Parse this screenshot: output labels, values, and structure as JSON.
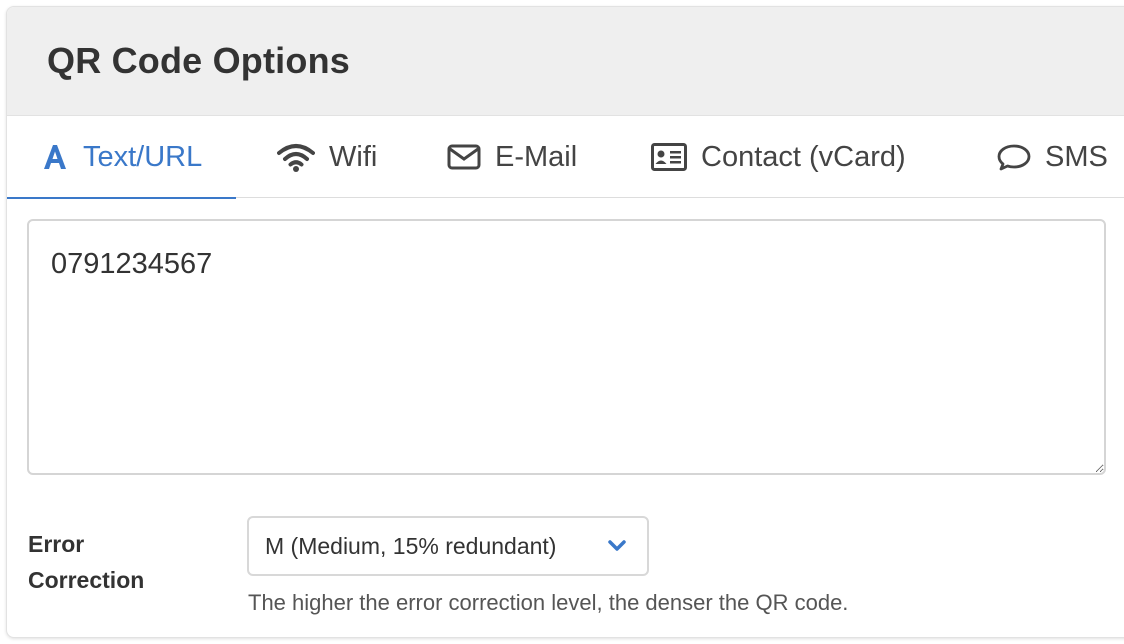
{
  "header": {
    "title": "QR Code Options"
  },
  "tabs": [
    {
      "label": "Text/URL",
      "icon": "text-icon",
      "active": true
    },
    {
      "label": "Wifi",
      "icon": "wifi-icon",
      "active": false
    },
    {
      "label": "E-Mail",
      "icon": "envelope-icon",
      "active": false
    },
    {
      "label": "Contact (vCard)",
      "icon": "contact-card-icon",
      "active": false
    },
    {
      "label": "SMS",
      "icon": "speech-bubble-icon",
      "active": false
    }
  ],
  "content": {
    "text_value": "0791234567"
  },
  "error_correction": {
    "label": "Error Correction",
    "selected": "M (Medium, 15% redundant)",
    "help": "The higher the error correction level, the denser the QR code."
  },
  "colors": {
    "accent": "#3a78c9",
    "header_bg": "#efefef",
    "text": "#333333"
  }
}
